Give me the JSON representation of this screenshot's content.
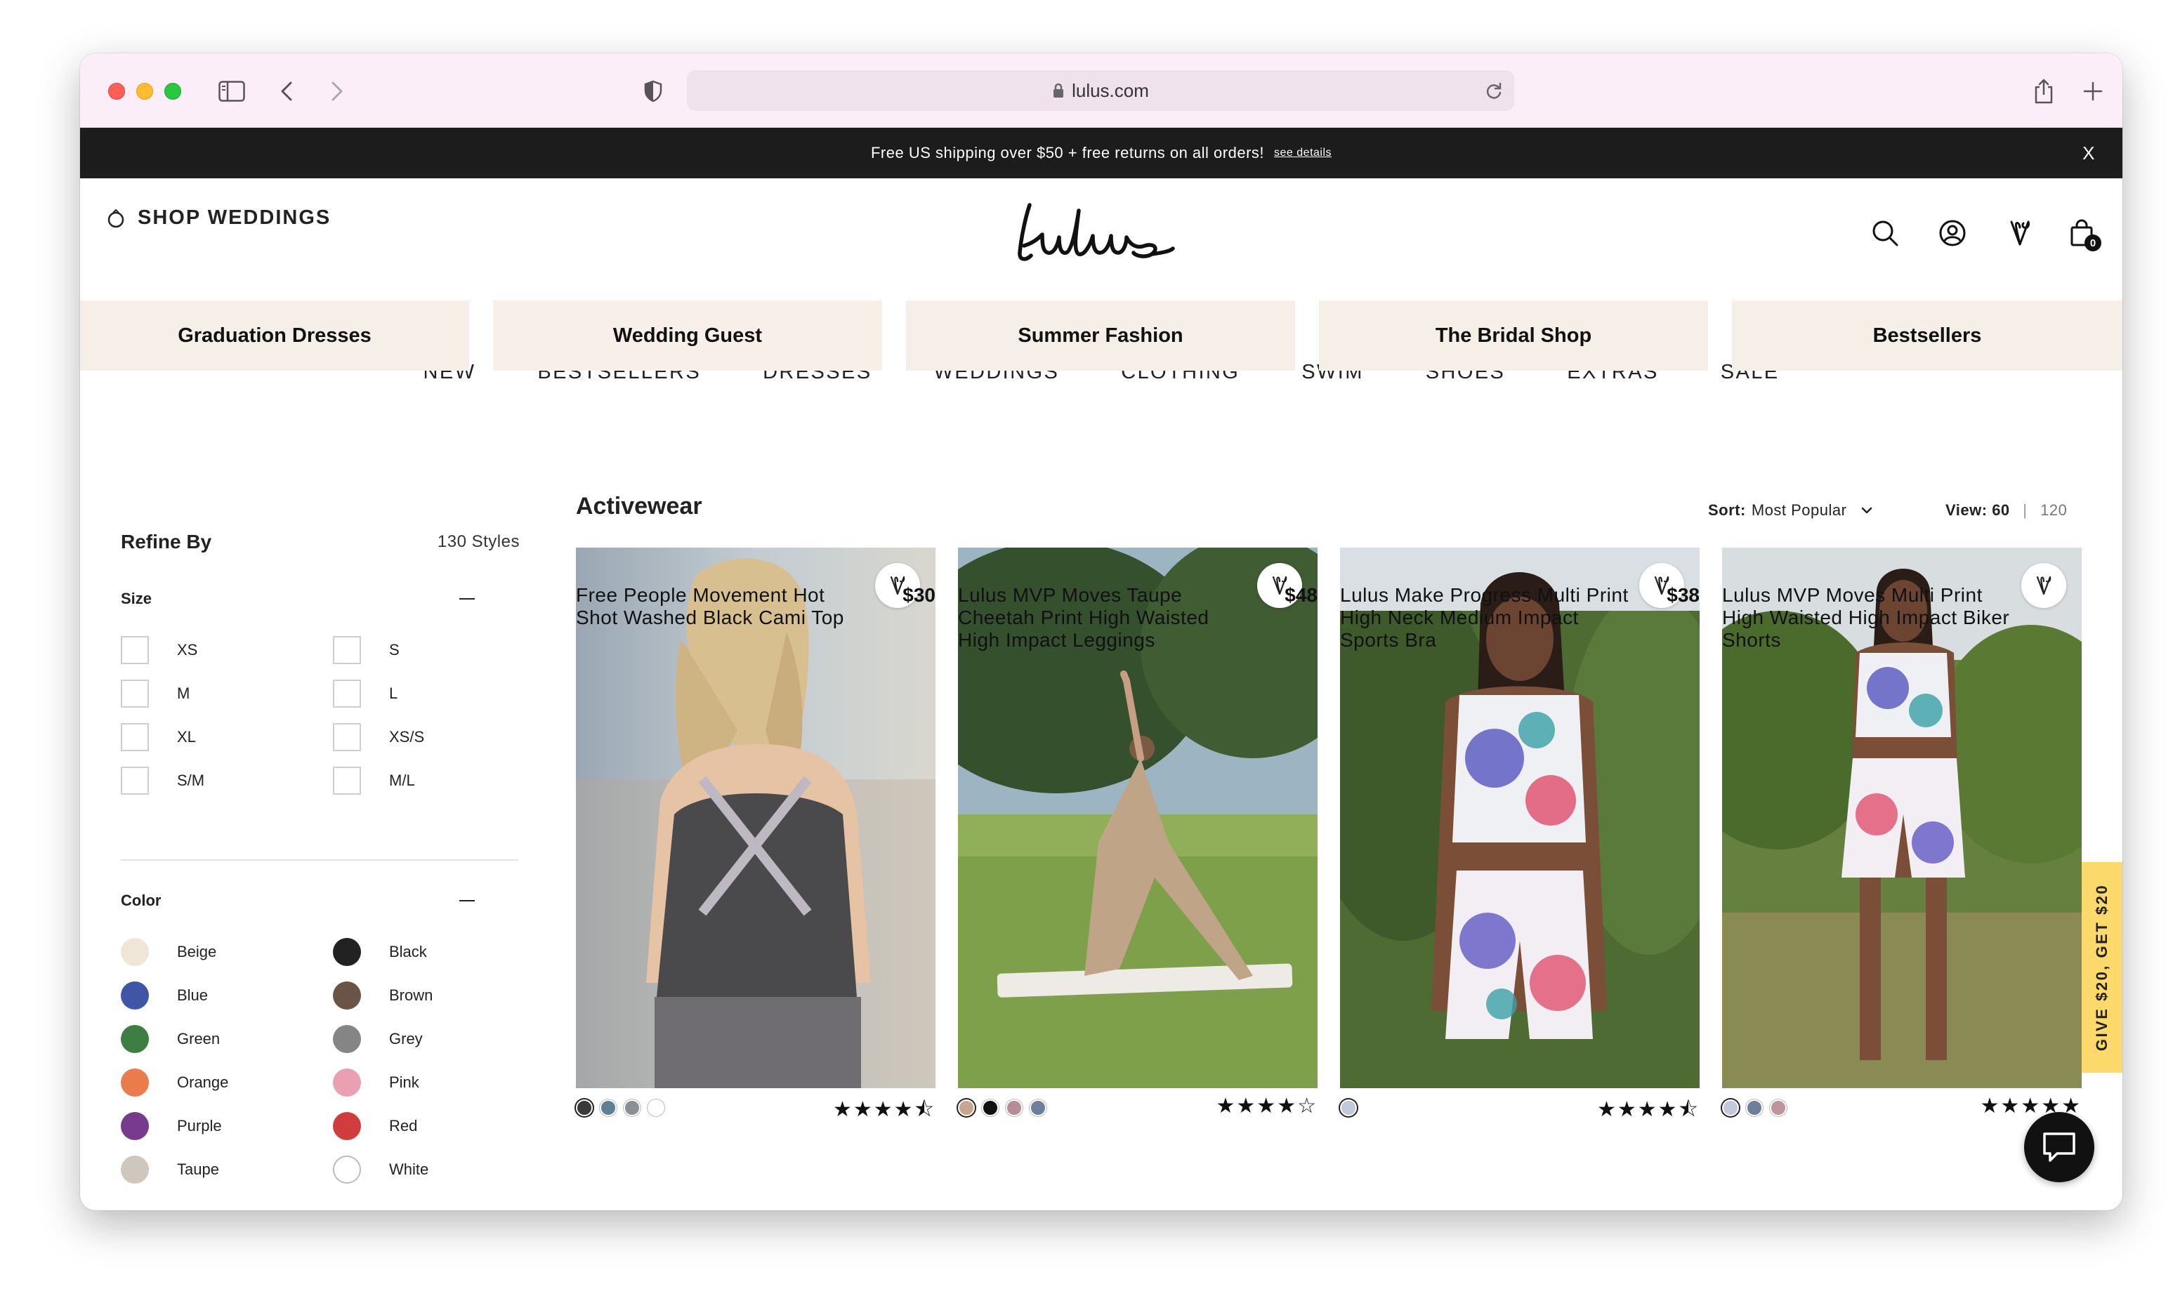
{
  "browser": {
    "url": "lulus.com"
  },
  "announcement": {
    "text": "Free US shipping over $50 + free returns on all orders!",
    "link": "see details",
    "close": "X"
  },
  "header": {
    "shop_weddings": "SHOP WEDDINGS",
    "logo_text": "Lulus",
    "cart_count": "0"
  },
  "nav": [
    "NEW",
    "BESTSELLERS",
    "DRESSES",
    "WEDDINGS",
    "CLOTHING",
    "SWIM",
    "SHOES",
    "EXTRAS",
    "SALE"
  ],
  "tiles": [
    "Graduation Dresses",
    "Wedding Guest",
    "Summer Fashion",
    "The Bridal Shop",
    "Bestsellers"
  ],
  "filters": {
    "title": "Refine By",
    "count": "130 Styles",
    "size_title": "Size",
    "sizes": [
      "XS",
      "S",
      "M",
      "L",
      "XL",
      "XS/S",
      "S/M",
      "M/L"
    ],
    "color_title": "Color",
    "colors": [
      {
        "name": "Beige",
        "hex": "#efe6d8"
      },
      {
        "name": "Black",
        "hex": "#222222"
      },
      {
        "name": "Blue",
        "hex": "#3f56a7"
      },
      {
        "name": "Brown",
        "hex": "#6b5345"
      },
      {
        "name": "Green",
        "hex": "#3d7e43"
      },
      {
        "name": "Grey",
        "hex": "#858585"
      },
      {
        "name": "Orange",
        "hex": "#e97c4a"
      },
      {
        "name": "Pink",
        "hex": "#e9a0b0"
      },
      {
        "name": "Purple",
        "hex": "#763b8d"
      },
      {
        "name": "Red",
        "hex": "#d13c3f"
      },
      {
        "name": "Taupe",
        "hex": "#cfc6bd"
      },
      {
        "name": "White",
        "hex": "#ffffff"
      }
    ]
  },
  "listing": {
    "title": "Activewear",
    "sort_label": "Sort:",
    "sort_value": "Most Popular",
    "view_label": "View:",
    "view_current": "60",
    "view_separator": "|",
    "view_alt": "120"
  },
  "products": [
    {
      "name": "Free People Movement Hot Shot Washed Black Cami Top",
      "price": "$30",
      "rating": 4.5,
      "swatches": [
        "#3a3a3a",
        "#5e7f96",
        "#8d8f96",
        "#ffffff"
      ]
    },
    {
      "name": "Lulus MVP Moves Taupe Cheetah Print High Waisted High Impact Leggings",
      "price": "$48",
      "rating": 4,
      "swatches": [
        "#c9a58d",
        "#111111",
        "#b48d95",
        "#6d7f99"
      ]
    },
    {
      "name": "Lulus Make Progress Multi Print High Neck Medium Impact Sports Bra",
      "price": "$38",
      "rating": 4.5,
      "swatches": [
        "#c3c9d8"
      ]
    },
    {
      "name": "Lulus MVP Moves Multi Print High Waisted High Impact Biker Shorts",
      "price": "",
      "rating": 5,
      "swatches": [
        "#c3c9d8",
        "#6d7f99",
        "#c0949b"
      ]
    }
  ],
  "promo_tab": "GIVE $20, GET $20"
}
